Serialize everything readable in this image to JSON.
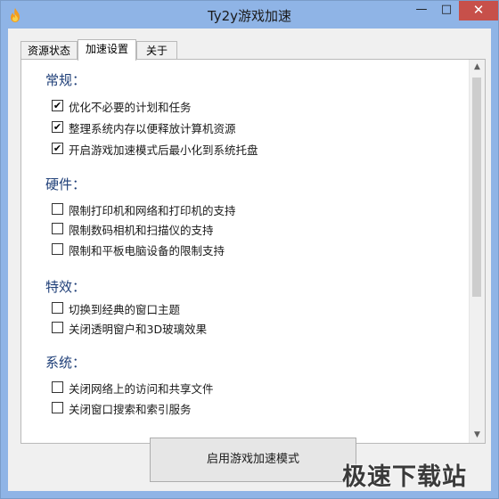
{
  "window": {
    "title": "Ty2y游戏加速",
    "minimize_glyph": "—",
    "maximize_glyph": "□",
    "close_glyph": "✕",
    "app_icon": "flame-icon",
    "close_color": "#c7504a",
    "frame_color": "#8fb4e6"
  },
  "tabs": [
    {
      "label": "资源状态",
      "active": false
    },
    {
      "label": "加速设置",
      "active": true
    },
    {
      "label": "关于",
      "active": false
    }
  ],
  "sections": {
    "general": {
      "title": "常规："
    },
    "hardware": {
      "title": "硬件："
    },
    "effects": {
      "title": "特效："
    },
    "system": {
      "title": "系统："
    }
  },
  "options": {
    "general": [
      {
        "label": "优化不必要的计划和任务",
        "checked": true
      },
      {
        "label": "整理系统内存以便释放计算机资源",
        "checked": true
      },
      {
        "label": "开启游戏加速模式后最小化到系统托盘",
        "checked": true
      }
    ],
    "hardware": [
      {
        "label": "限制打印机和网络和打印机的支持",
        "checked": false
      },
      {
        "label": "限制数码相机和扫描仪的支持",
        "checked": false
      },
      {
        "label": "限制和平板电脑设备的限制支持",
        "checked": false
      }
    ],
    "effects": [
      {
        "label": "切换到经典的窗口主题",
        "checked": false
      },
      {
        "label": "关闭透明窗户和3D玻璃效果",
        "checked": false
      }
    ],
    "system": [
      {
        "label": "关闭网络上的访问和共享文件",
        "checked": false
      },
      {
        "label": "关闭窗口搜索和索引服务",
        "checked": false
      }
    ]
  },
  "check_mark": "✔",
  "scroll": {
    "up_glyph": "▲",
    "down_glyph": "▼"
  },
  "actions": {
    "start_label": "启用游戏加速模式"
  },
  "watermark": {
    "text": "极速下载站"
  }
}
